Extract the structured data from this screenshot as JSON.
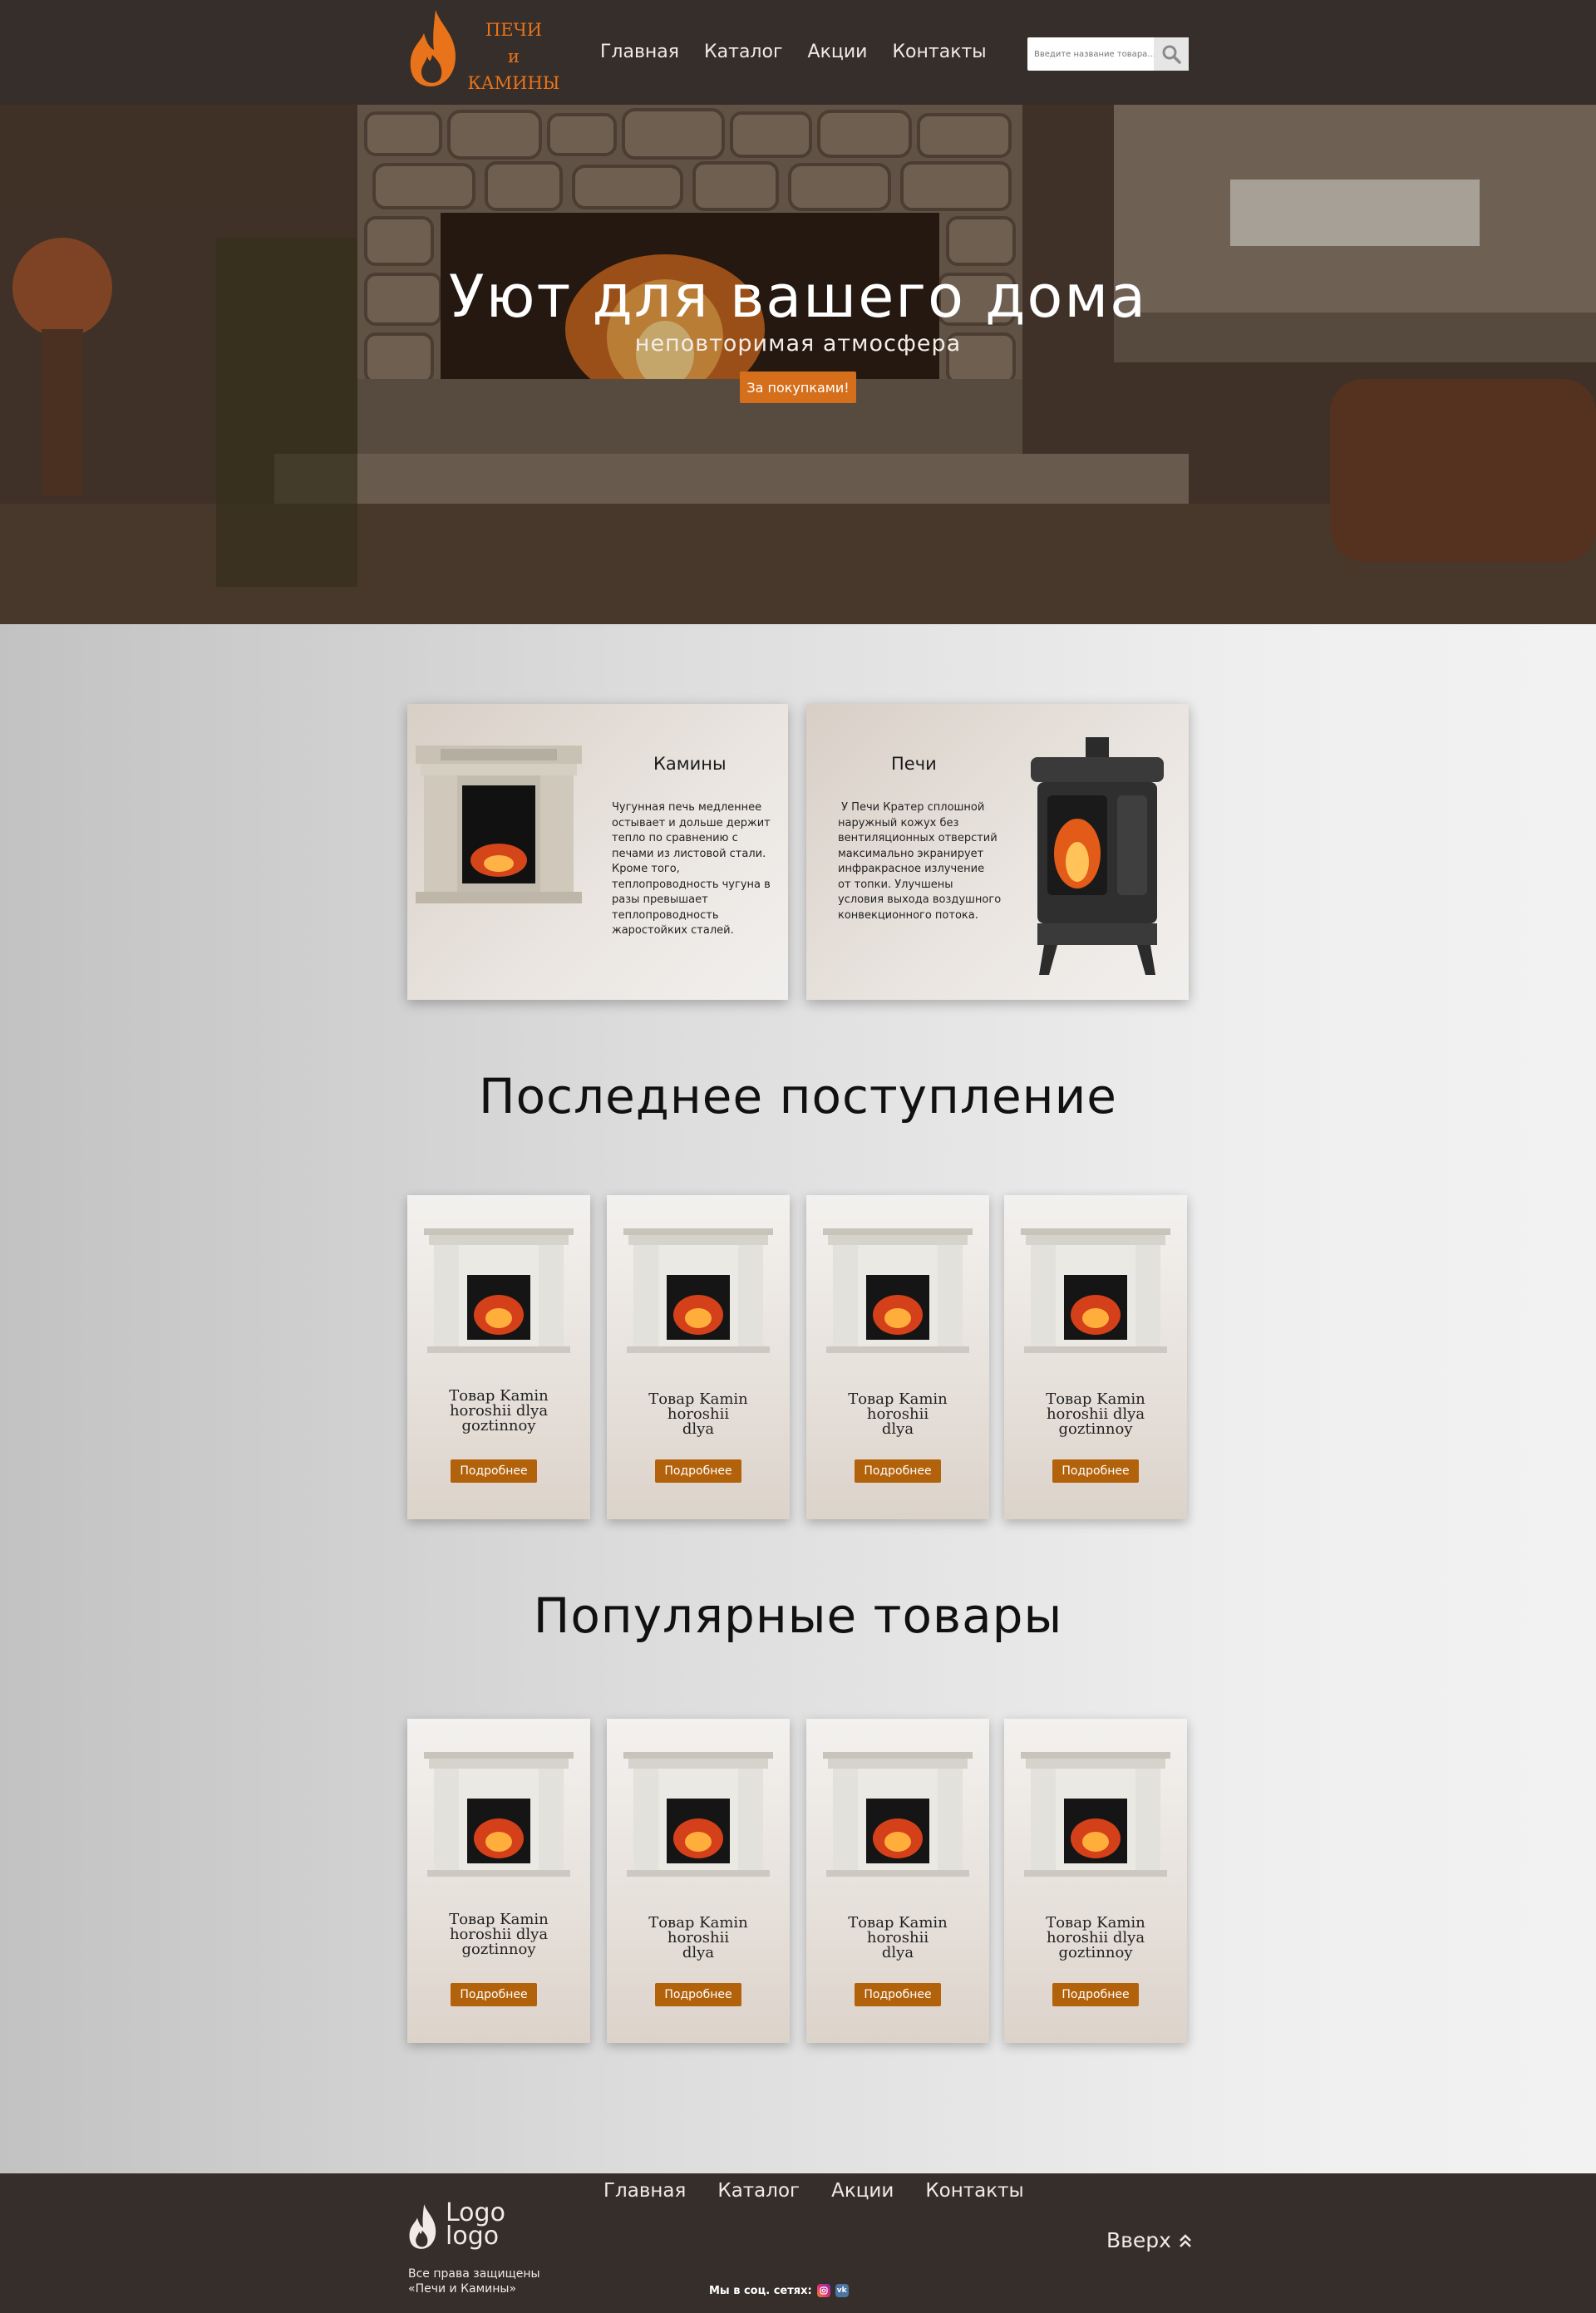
{
  "header": {
    "logo_lines": [
      "ПЕЧИ",
      "и",
      "КАМИНЫ"
    ],
    "nav": [
      "Главная",
      "Каталог",
      "Акции",
      "Контакты"
    ],
    "search_placeholder": "Введите название товара..."
  },
  "hero": {
    "title": "Уют для вашего дома",
    "subtitle": "неповторимая атмосфера",
    "button": "За покупками!"
  },
  "categories": [
    {
      "title": "Камины",
      "lines": [
        "Чугунная печь медленнее",
        "остывает и дольше держит",
        "тепло по сравнению с",
        "печами из листовой стали.",
        "Кроме того,",
        "теплопроводность чугуна в",
        "разы превышает",
        "теплопроводность",
        "жаростойких сталей."
      ]
    },
    {
      "title": "Печи",
      "lines": [
        " У Печи Кратер сплошной",
        "наружный кожух без",
        "вентиляционных отверстий",
        "максимально экранирует",
        "инфракрасное излучение",
        "от топки. Улучшены",
        "условия выхода воздушного",
        "конвекционного потока."
      ]
    }
  ],
  "latest": {
    "title": "Последнее поступление",
    "products": [
      {
        "name_lines": [
          "Товар Kamin",
          "horoshii dlya",
          "goztinnoy"
        ],
        "button": "Подробнее"
      },
      {
        "name_lines": [
          "Товар Kamin",
          "horoshii",
          "dlya"
        ],
        "button": "Подробнее"
      },
      {
        "name_lines": [
          "Товар Kamin",
          "horoshii",
          "dlya"
        ],
        "button": "Подробнее"
      },
      {
        "name_lines": [
          "Товар Kamin",
          "horoshii dlya",
          "goztinnoy"
        ],
        "button": "Подробнее"
      }
    ]
  },
  "popular": {
    "title": "Популярные товары",
    "products": [
      {
        "name_lines": [
          "Товар Kamin",
          "horoshii dlya",
          "goztinnoy"
        ],
        "button": "Подробнее"
      },
      {
        "name_lines": [
          "Товар Kamin",
          "horoshii",
          "dlya"
        ],
        "button": "Подробнее"
      },
      {
        "name_lines": [
          "Товар Kamin",
          "horoshii",
          "dlya"
        ],
        "button": "Подробнее"
      },
      {
        "name_lines": [
          "Товар Kamin",
          "horoshii dlya",
          "goztinnoy"
        ],
        "button": "Подробнее"
      }
    ]
  },
  "footer": {
    "nav": [
      "Главная",
      "Каталог",
      "Акции",
      "Контакты"
    ],
    "logo_lines": [
      "Logo",
      "logo"
    ],
    "copyright_lines": [
      "Все права защищены",
      "«Печи и Камины»"
    ],
    "social_label": "Мы в соц. сетях:",
    "up_label": "Вверх"
  },
  "colors": {
    "header_bg": "#362e2b",
    "accent_orange": "#e8731a",
    "button_brown": "#b3620c"
  },
  "icons": [
    "flame-icon",
    "search-icon",
    "instagram-icon",
    "vk-icon",
    "double-chevron-up-icon"
  ]
}
